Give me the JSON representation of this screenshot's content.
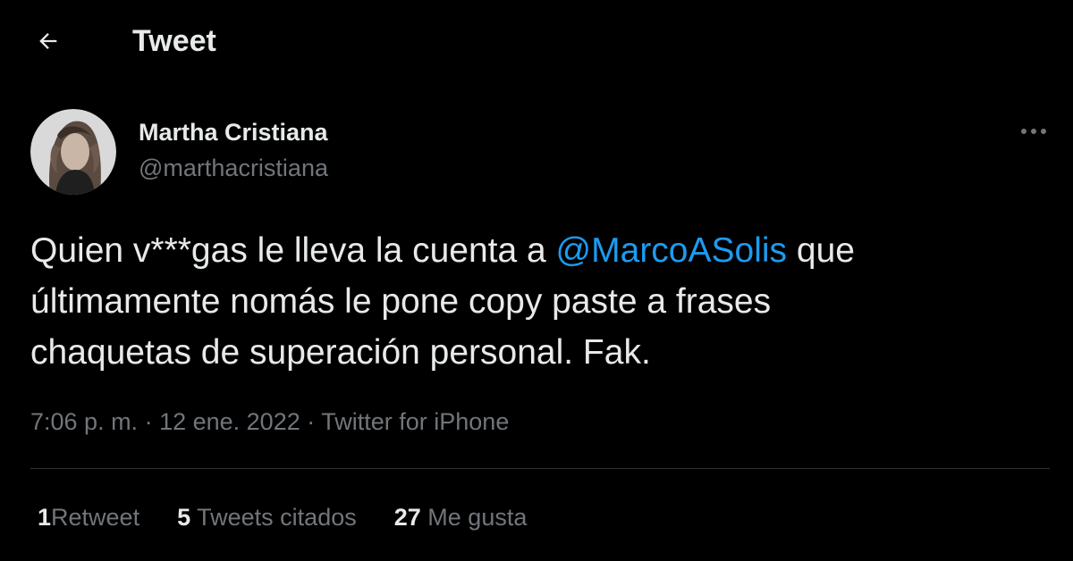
{
  "header": {
    "back_icon": "arrow-left-icon",
    "title": "Tweet"
  },
  "author": {
    "name": "Martha Cristiana",
    "handle": "@marthacristiana",
    "avatar": "profile-photo"
  },
  "more_icon": "more-horizontal-icon",
  "tweet": {
    "line1_a": "Quien v***gas le lleva la cuenta a ",
    "mention": "@MarcoASolis",
    "line1_b": " que",
    "line2": "últimamente nomás le pone copy paste a frases",
    "line3": "chaquetas de superación personal. Fak."
  },
  "meta": {
    "time": "7:06 p. m.",
    "separator": " · ",
    "date": "12 ene. 2022",
    "source": "Twitter for iPhone"
  },
  "stats": [
    {
      "count": "1",
      "label": "Retweet"
    },
    {
      "count": "5",
      "label": "Tweets citados"
    },
    {
      "count": "27",
      "label": "Me gusta"
    }
  ],
  "colors": {
    "background": "#000000",
    "text": "#e7e9ea",
    "secondary": "#71767b",
    "accent": "#1d9bf0",
    "divider": "#2f3336"
  }
}
